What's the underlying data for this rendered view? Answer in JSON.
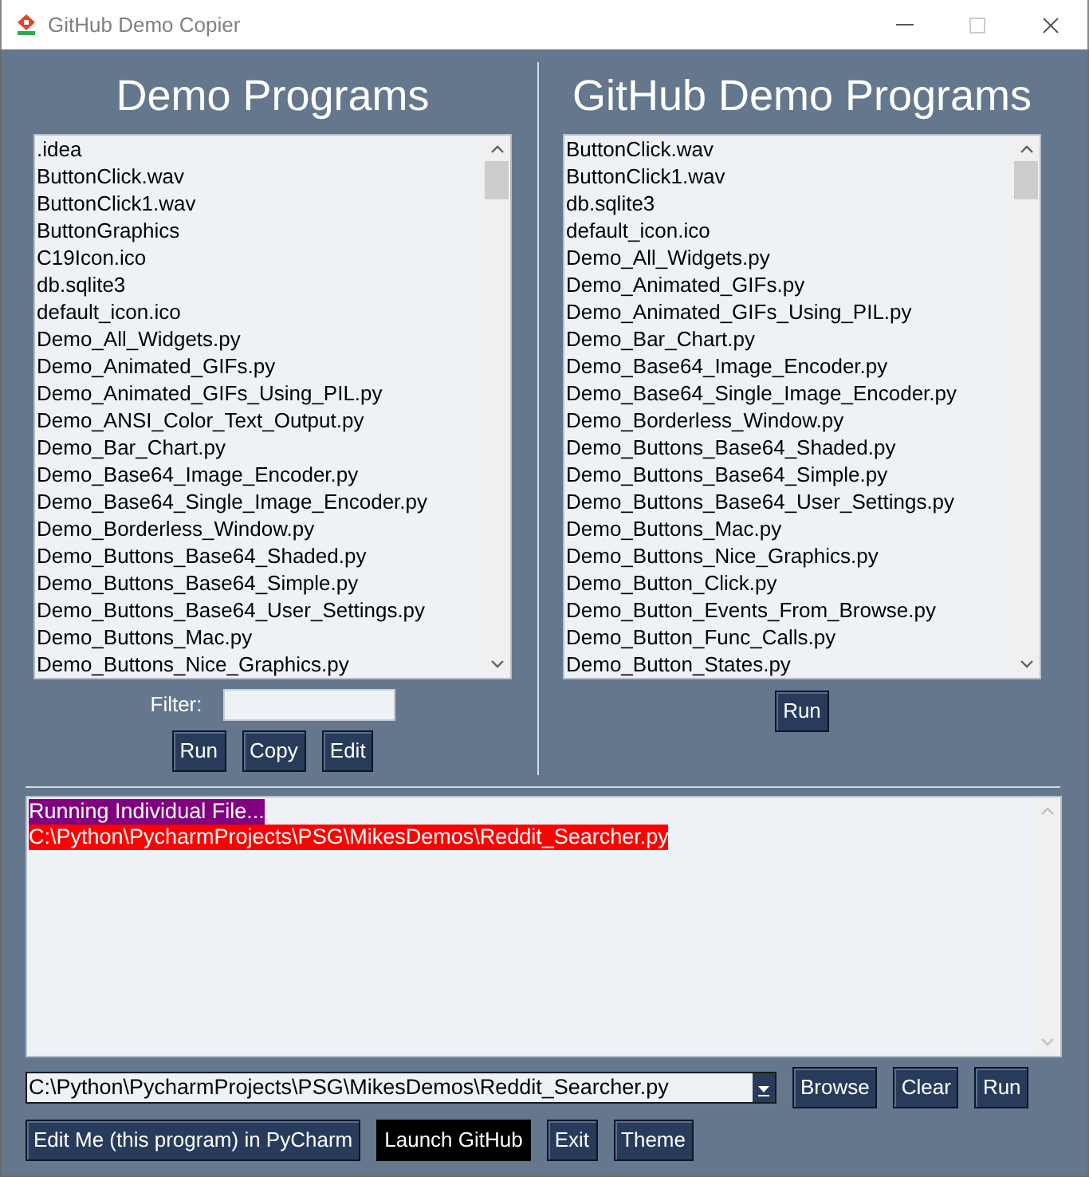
{
  "window": {
    "title": "GitHub Demo Copier",
    "controls": [
      {
        "kind": "minimize",
        "disabled": false
      },
      {
        "kind": "maximize",
        "disabled": true
      },
      {
        "kind": "close",
        "disabled": false
      }
    ]
  },
  "demo_programs": {
    "heading": "Demo Programs",
    "files": [
      ".idea",
      "ButtonClick.wav",
      "ButtonClick1.wav",
      "ButtonGraphics",
      "C19Icon.ico",
      "db.sqlite3",
      "default_icon.ico",
      "Demo_All_Widgets.py",
      "Demo_Animated_GIFs.py",
      "Demo_Animated_GIFs_Using_PIL.py",
      "Demo_ANSI_Color_Text_Output.py",
      "Demo_Bar_Chart.py",
      "Demo_Base64_Image_Encoder.py",
      "Demo_Base64_Single_Image_Encoder.py",
      "Demo_Borderless_Window.py",
      "Demo_Buttons_Base64_Shaded.py",
      "Demo_Buttons_Base64_Simple.py",
      "Demo_Buttons_Base64_User_Settings.py",
      "Demo_Buttons_Mac.py",
      "Demo_Buttons_Nice_Graphics.py"
    ],
    "filter": {
      "label": "Filter:"
    },
    "buttons": [
      "Run",
      "Copy",
      "Edit"
    ]
  },
  "github_demo_programs": {
    "heading": "GitHub Demo Programs",
    "files": [
      "ButtonClick.wav",
      "ButtonClick1.wav",
      "db.sqlite3",
      "default_icon.ico",
      "Demo_All_Widgets.py",
      "Demo_Animated_GIFs.py",
      "Demo_Animated_GIFs_Using_PIL.py",
      "Demo_Bar_Chart.py",
      "Demo_Base64_Image_Encoder.py",
      "Demo_Base64_Single_Image_Encoder.py",
      "Demo_Borderless_Window.py",
      "Demo_Buttons_Base64_Shaded.py",
      "Demo_Buttons_Base64_Simple.py",
      "Demo_Buttons_Base64_User_Settings.py",
      "Demo_Buttons_Mac.py",
      "Demo_Buttons_Nice_Graphics.py",
      "Demo_Button_Click.py",
      "Demo_Button_Events_From_Browse.py",
      "Demo_Button_Func_Calls.py",
      "Demo_Button_States.py"
    ],
    "buttons": [
      "Run"
    ]
  },
  "output": {
    "lines": [
      {
        "text": "Running Individual File...",
        "color": "#800080"
      },
      {
        "text": "C:\\Python\\PycharmProjects\\PSG\\MikesDemos\\Reddit_Searcher.py",
        "color": "#ff0000"
      }
    ]
  },
  "path_combo": {
    "value": "C:\\Python\\PycharmProjects\\PSG\\MikesDemos\\Reddit_Searcher.py"
  },
  "path_buttons": [
    "Browse",
    "Clear",
    "Run"
  ],
  "bottom_buttons": [
    {
      "label": "Edit Me (this program) in PyCharm",
      "kind": "normal"
    },
    {
      "label": "Launch GitHub",
      "kind": "highlighted"
    },
    {
      "label": "Exit",
      "kind": "normal"
    },
    {
      "label": "Theme",
      "kind": "normal"
    }
  ]
}
